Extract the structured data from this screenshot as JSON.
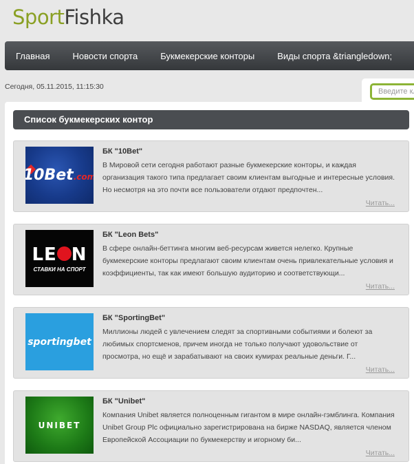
{
  "logo": {
    "part1": "Sport",
    "part2": "Fishka"
  },
  "nav": [
    {
      "label": "Главная"
    },
    {
      "label": "Новости спорта"
    },
    {
      "label": "Букмекерские конторы"
    },
    {
      "label": "Виды спорта &triangledown;"
    }
  ],
  "date": "Сегодня, 05.11.2015, 11:15:30",
  "search": {
    "placeholder": "Введите кл"
  },
  "section_title": "Список букмекерских контор",
  "read_label": "Читать...",
  "cards": [
    {
      "title": "БК \"10Bet\"",
      "text": "В Мировой сети сегодня работают разные букмекерские конторы, и каждая организация такого типа предлагает своим клиентам выгодные и интересные условия. Но несмотря на это почти все пользователи отдают предпочтен...",
      "logo": {
        "text": "10Bet",
        "suffix": ".com"
      }
    },
    {
      "title": "БК \"Leon Bets\"",
      "text": "В сфере онлайн-беттинга многим веб-ресурсам живется нелегко. Крупные букмекерские конторы предлагают своим клиентам очень привлекательные условия и коэффициенты, так как имеют большую аудиторию и соответствующи...",
      "logo": {
        "text_a": "LE",
        "text_b": "N",
        "sub": "СТАВКИ НА СПОРТ"
      }
    },
    {
      "title": "БК \"SportingBet\"",
      "text": "Миллионы людей с увлечением следят за спортивными событиями и болеют за любимых спортсменов, причем иногда не только получают удовольствие от просмотра, но ещё и зарабатывают на своих кумирах реальные деньги. Г...",
      "logo": {
        "text": "sportingbet"
      }
    },
    {
      "title": "БК \"Unibet\"",
      "text": "Компания Unibet является полноценным гигантом в мире онлайн-гэмблинга. Компания Unibet Group Plc официально зарегистрирована на бирже NASDAQ, является членом Европейской Ассоциации по букмекерству и игорному би...",
      "logo": {
        "text": "UNIBET"
      }
    }
  ],
  "colors": {
    "accent": "#8cb436",
    "nav_bg": "#45484c",
    "header_bg": "#4a4d51"
  }
}
